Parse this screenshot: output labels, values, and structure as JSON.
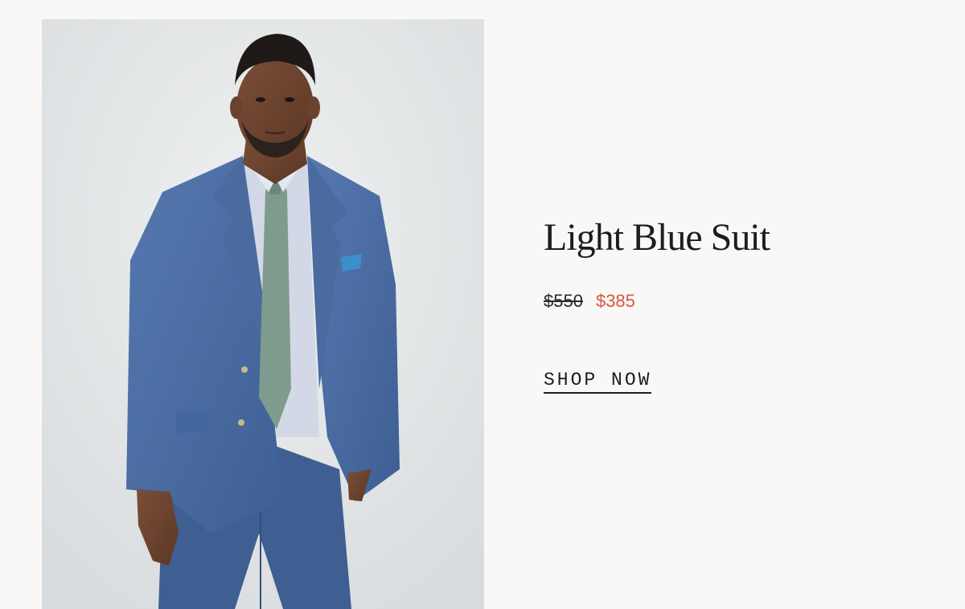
{
  "product": {
    "title": "Light Blue Suit",
    "price_original": "$550",
    "price_sale": "$385",
    "cta_label": "SHOP NOW"
  },
  "colors": {
    "background": "#f9f8f6",
    "sale_price": "#d9573e",
    "text": "#1d1d1d",
    "suit": "#4a6fa5"
  }
}
